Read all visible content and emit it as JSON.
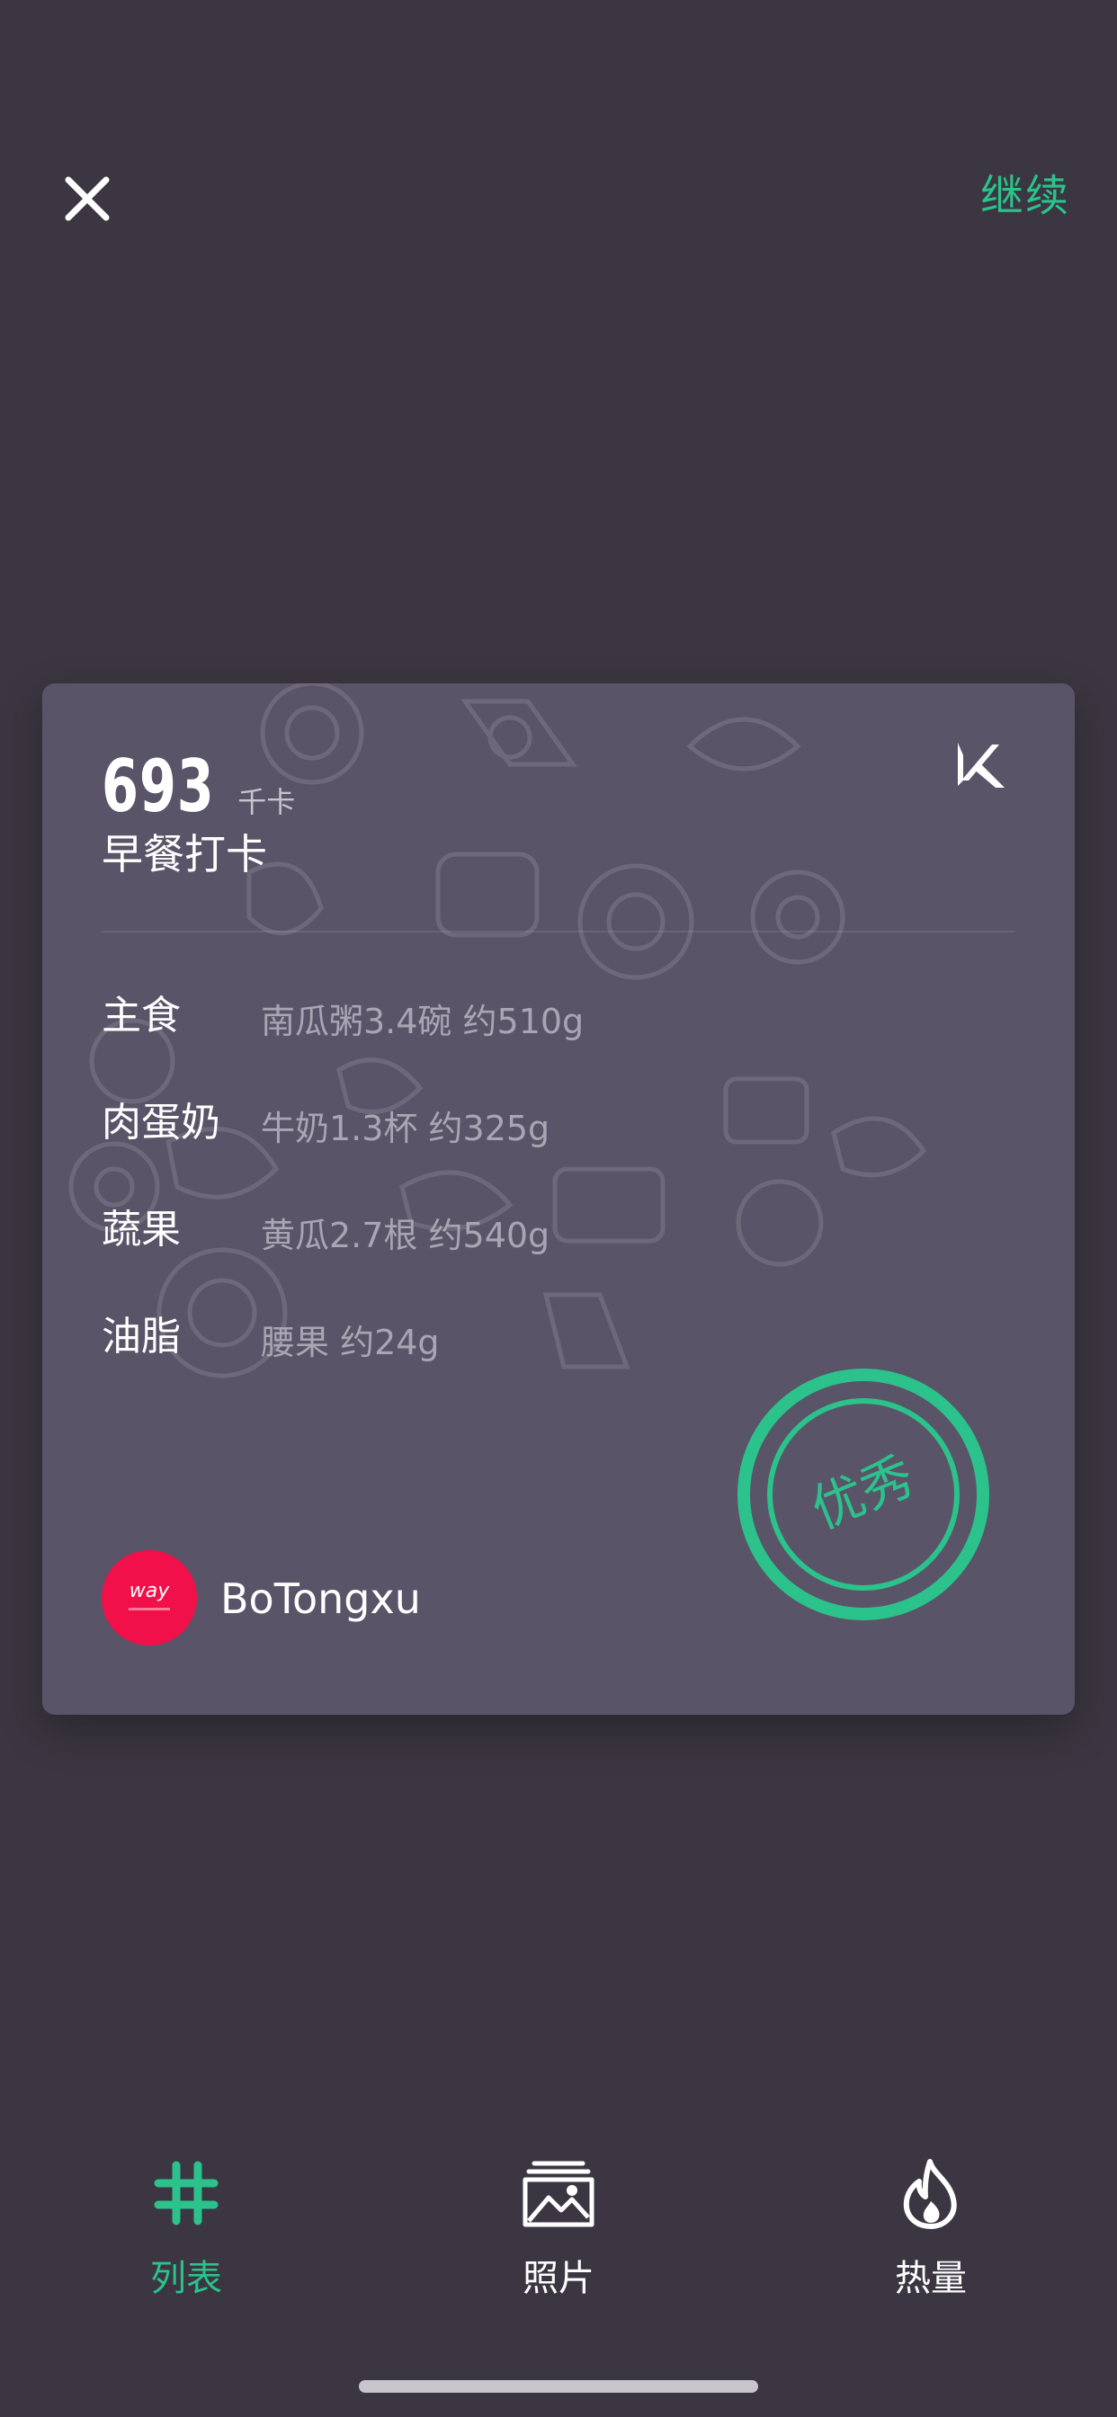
{
  "topbar": {
    "close_icon": "close-icon",
    "continue_label": "继续"
  },
  "card": {
    "kcal_value": "693",
    "kcal_unit": "千卡",
    "meal_title": "早餐打卡",
    "brand_icon": "keep-k-logo-icon",
    "foods": [
      {
        "label": "主食",
        "detail": "南瓜粥3.4碗 约510g"
      },
      {
        "label": "肉蛋奶",
        "detail": "牛奶1.3杯 约325g"
      },
      {
        "label": "蔬果",
        "detail": "黄瓜2.7根 约540g"
      },
      {
        "label": "油脂",
        "detail": "腰果 约24g"
      }
    ],
    "stamp_text": "优秀",
    "user": {
      "avatar_text": "way",
      "name": "BoTongxu"
    }
  },
  "tabs": [
    {
      "label": "列表",
      "icon": "hashtag-icon",
      "active": true
    },
    {
      "label": "照片",
      "icon": "image-icon",
      "active": false
    },
    {
      "label": "热量",
      "icon": "flame-icon",
      "active": false
    }
  ],
  "colors": {
    "background": "#3b3641",
    "card": "#5a5468",
    "accent": "#2bc28b",
    "avatar": "#f11049"
  }
}
